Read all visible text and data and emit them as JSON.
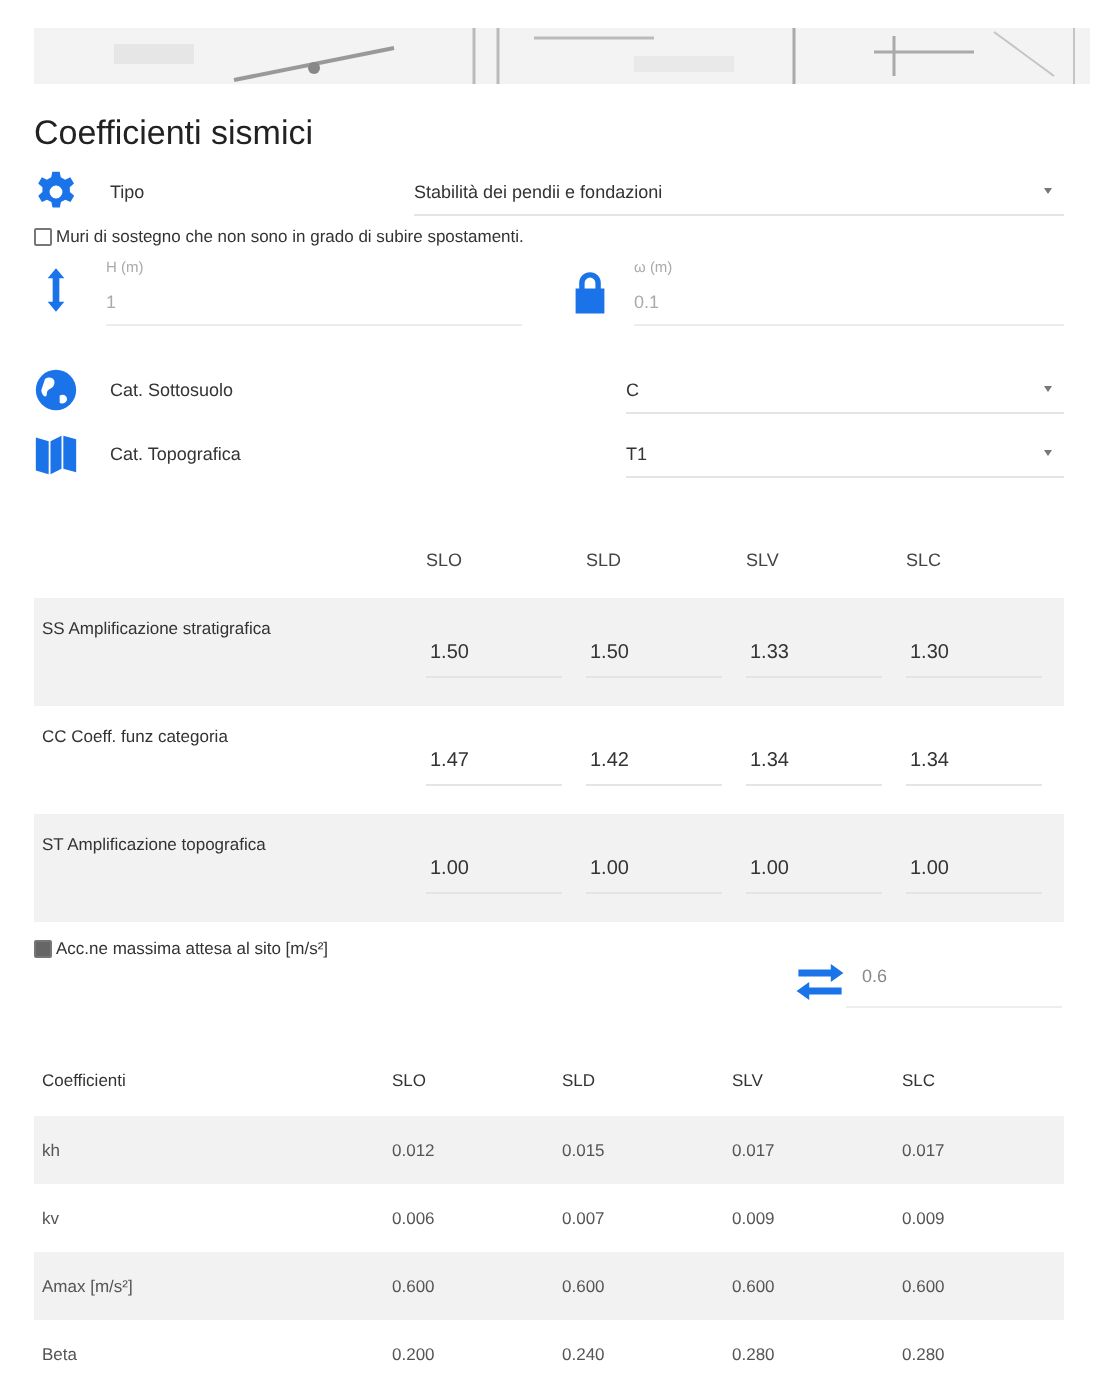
{
  "title": "Coefficienti sismici",
  "tipo": {
    "label": "Tipo",
    "value": "Stabilità dei pendii e fondazioni"
  },
  "muri": {
    "label": "Muri di sostegno che non sono in grado di subire spostamenti.",
    "checked": false
  },
  "fields": [
    {
      "label": "H (m)",
      "value": "1"
    },
    {
      "label": "ω (m)",
      "value": "0.1"
    }
  ],
  "selects": [
    {
      "label": "Cat. Sottosuolo",
      "value": "C"
    },
    {
      "label": "Cat. Topografica",
      "value": "T1"
    }
  ],
  "amp_table": {
    "columns": [
      "SLO",
      "SLD",
      "SLV",
      "SLC"
    ],
    "rows": [
      {
        "label": "SS Amplificazione stratigrafica",
        "values": [
          "1.50",
          "1.50",
          "1.33",
          "1.30"
        ]
      },
      {
        "label": "CC Coeff. funz categoria",
        "values": [
          "1.47",
          "1.42",
          "1.34",
          "1.34"
        ]
      },
      {
        "label": "ST Amplificazione topografica",
        "values": [
          "1.00",
          "1.00",
          "1.00",
          "1.00"
        ]
      }
    ]
  },
  "acc": {
    "label": "Acc.ne massima attesa al sito [m/s²]",
    "checked": true,
    "value": "0.6"
  },
  "coef_table": {
    "columns": [
      "Coefficienti",
      "SLO",
      "SLD",
      "SLV",
      "SLC"
    ],
    "rows": [
      [
        "kh",
        "0.012",
        "0.015",
        "0.017",
        "0.017"
      ],
      [
        "kv",
        "0.006",
        "0.007",
        "0.009",
        "0.009"
      ],
      [
        "Amax [m/s²]",
        "0.600",
        "0.600",
        "0.600",
        "0.600"
      ],
      [
        "Beta",
        "0.200",
        "0.240",
        "0.280",
        "0.280"
      ]
    ]
  }
}
